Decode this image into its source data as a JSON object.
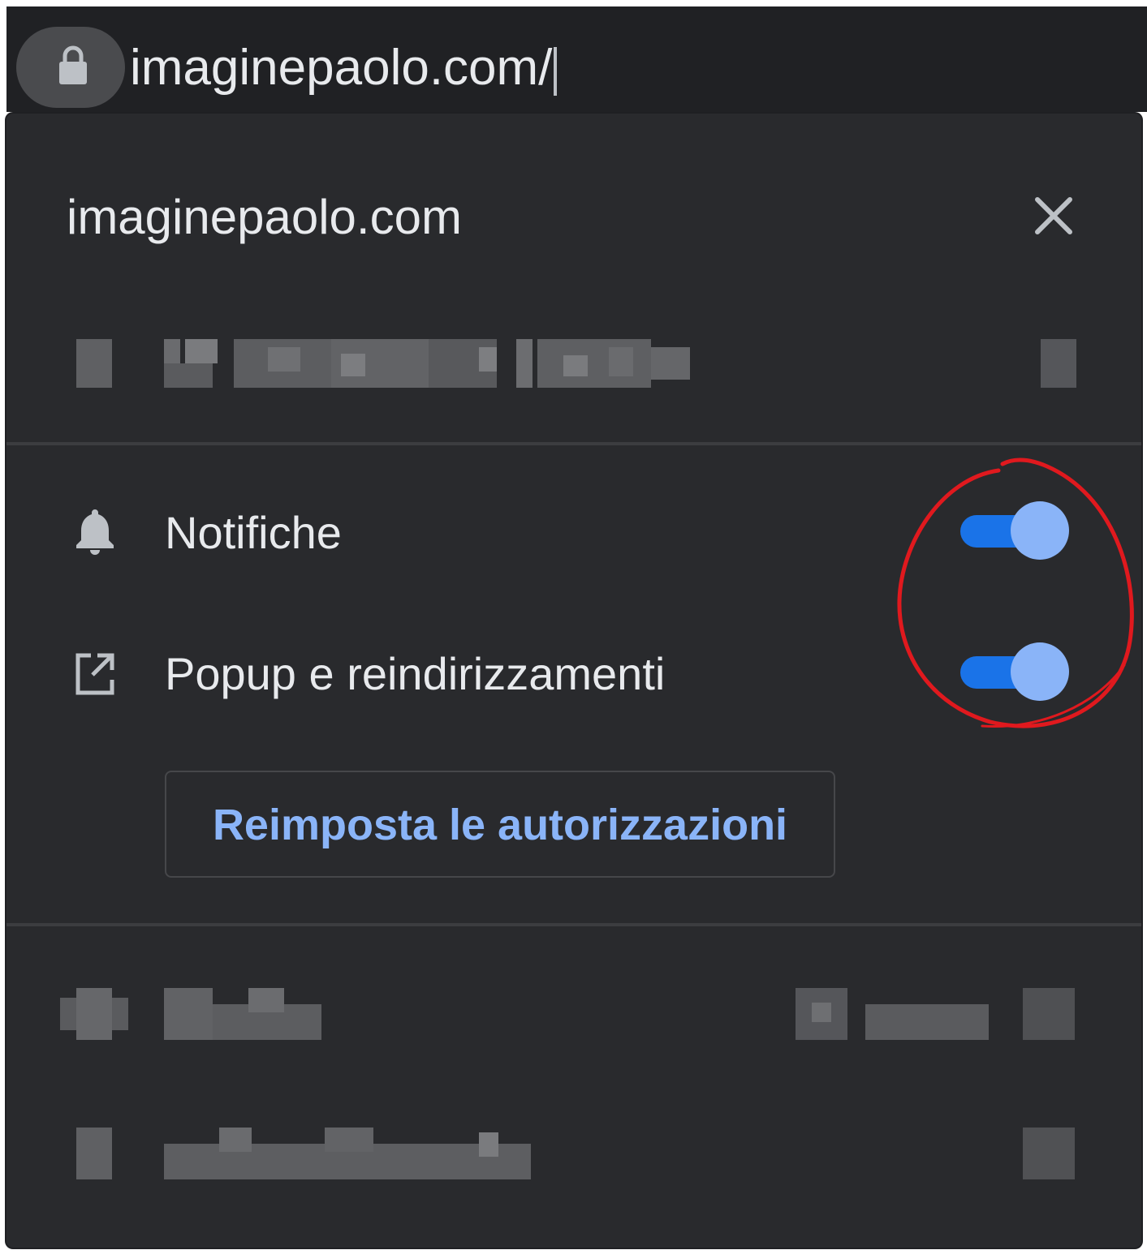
{
  "address_bar": {
    "url": "imaginepaolo.com/",
    "lock_icon": "lock-icon"
  },
  "popup": {
    "site_title": "imaginepaolo.com",
    "close_icon": "close-icon",
    "permissions": [
      {
        "label": "Notifiche",
        "icon": "bell-icon",
        "enabled": true
      },
      {
        "label": "Popup e reindirizzamenti",
        "icon": "open-in-new-icon",
        "enabled": true
      }
    ],
    "reset_button_label": "Reimposta le autorizzazioni"
  },
  "colors": {
    "background": "#292a2d",
    "address_bar": "#202124",
    "text": "#e8eaed",
    "accent": "#8ab4f8",
    "toggle_track": "#1a73e8",
    "annotation": "#e0191e"
  }
}
